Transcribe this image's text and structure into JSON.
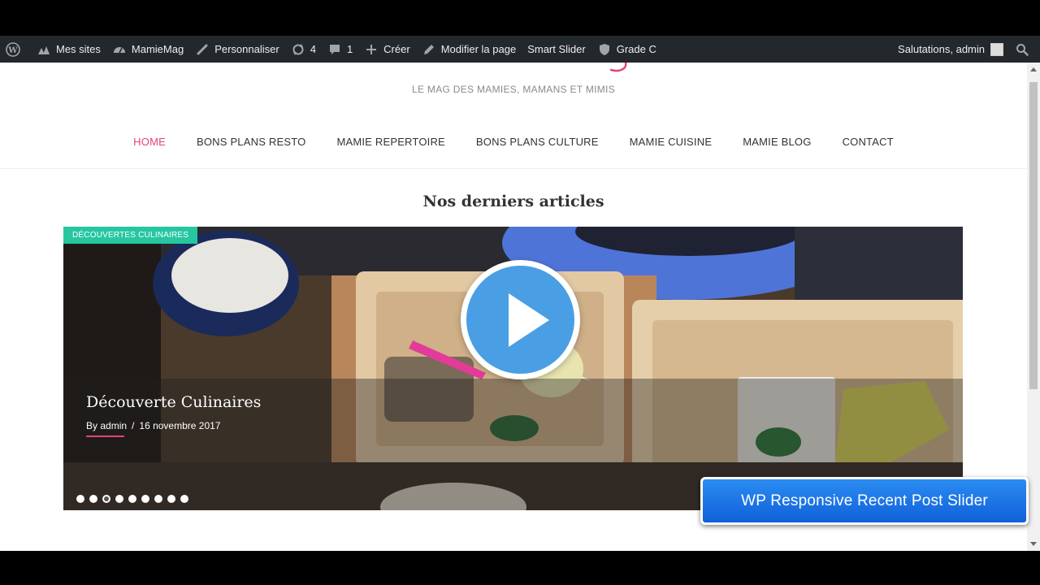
{
  "admin_bar": {
    "items": [
      {
        "icon": "wordpress-icon",
        "label": ""
      },
      {
        "icon": "sites-icon",
        "label": "Mes sites"
      },
      {
        "icon": "dashboard-icon",
        "label": "MamieMag"
      },
      {
        "icon": "brush-icon",
        "label": "Personnaliser"
      },
      {
        "icon": "updates-icon",
        "label": "4"
      },
      {
        "icon": "comments-icon",
        "label": "1"
      },
      {
        "icon": "plus-icon",
        "label": "Créer"
      },
      {
        "icon": "pencil-icon",
        "label": "Modifier la page"
      },
      {
        "icon": "",
        "label": "Smart Slider"
      },
      {
        "icon": "shield-icon",
        "label": "Grade C"
      }
    ],
    "greeting": "Salutations, admin"
  },
  "site": {
    "tagline": "LE MAG DES MAMIES, MAMANS ET MIMIS",
    "nav": [
      "HOME",
      "BONS PLANS RESTO",
      "MAMIE REPERTOIRE",
      "BONS PLANS CULTURE",
      "MAMIE CUISINE",
      "MAMIE BLOG",
      "CONTACT"
    ],
    "active_nav": "HOME",
    "section_title": "Nos derniers articles"
  },
  "slider": {
    "category": "DÉCOUVERTES CULINAIRES",
    "title": "Découverte Culinaires",
    "author_prefix": "By",
    "author": "admin",
    "date": "16 novembre 2017",
    "dot_count": 9,
    "active_dot": 2
  },
  "promo": {
    "label": "WP Responsive Recent Post Slider"
  },
  "colors": {
    "accent_pink": "#e0457b",
    "badge_green": "#26c6a0",
    "admin_bar": "#23282d",
    "play_blue": "#4a9ee3",
    "promo_blue": "#1f74e4"
  }
}
